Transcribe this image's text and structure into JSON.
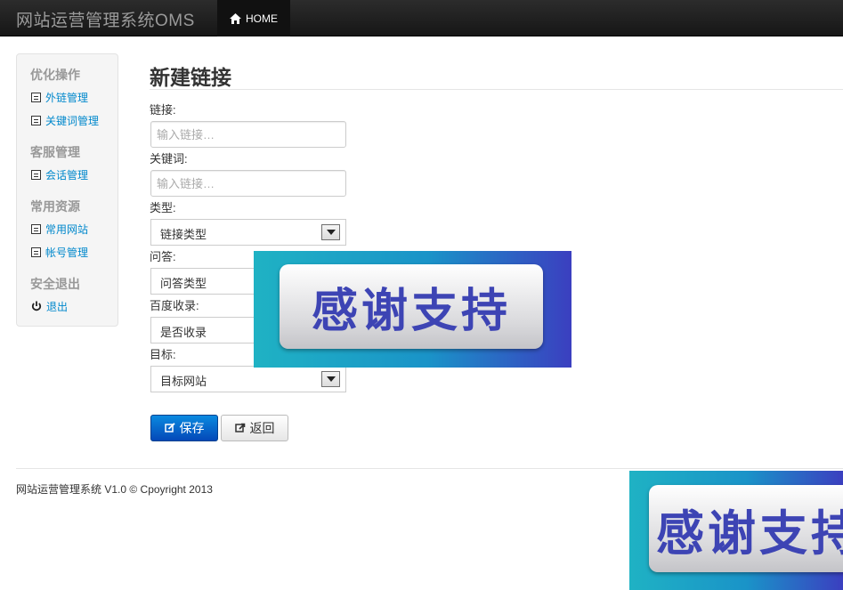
{
  "navbar": {
    "brand": "网站运营管理系统OMS",
    "home_label": "HOME"
  },
  "sidebar": {
    "sections": [
      {
        "header": "优化操作",
        "items": [
          "外链管理",
          "关键词管理"
        ]
      },
      {
        "header": "客服管理",
        "items": [
          "会话管理"
        ]
      },
      {
        "header": "常用资源",
        "items": [
          "常用网站",
          "帐号管理"
        ]
      },
      {
        "header": "安全退出",
        "items": [
          "退出"
        ]
      }
    ]
  },
  "main": {
    "title": "新建链接",
    "fields": {
      "link": {
        "label": "链接:",
        "placeholder": "输入链接…"
      },
      "keyword": {
        "label": "关键词:",
        "placeholder": "输入链接…"
      },
      "type": {
        "label": "类型:",
        "value": "链接类型"
      },
      "qa": {
        "label": "问答:",
        "value": "问答类型"
      },
      "baidu": {
        "label": "百度收录:",
        "value": "是否收录"
      },
      "target": {
        "label": "目标:",
        "value": "目标网站"
      }
    },
    "save_label": "保存",
    "back_label": "返回"
  },
  "footer": {
    "text": "网站运营管理系统 V1.0 © Cpoyright 2013"
  },
  "overlay": {
    "banner_text": "感谢支持"
  },
  "colors": {
    "link": "#0088cc",
    "primary_button": "#0448b8",
    "navbar": "#1b1b1b",
    "banner_text": "#3d44b4"
  }
}
